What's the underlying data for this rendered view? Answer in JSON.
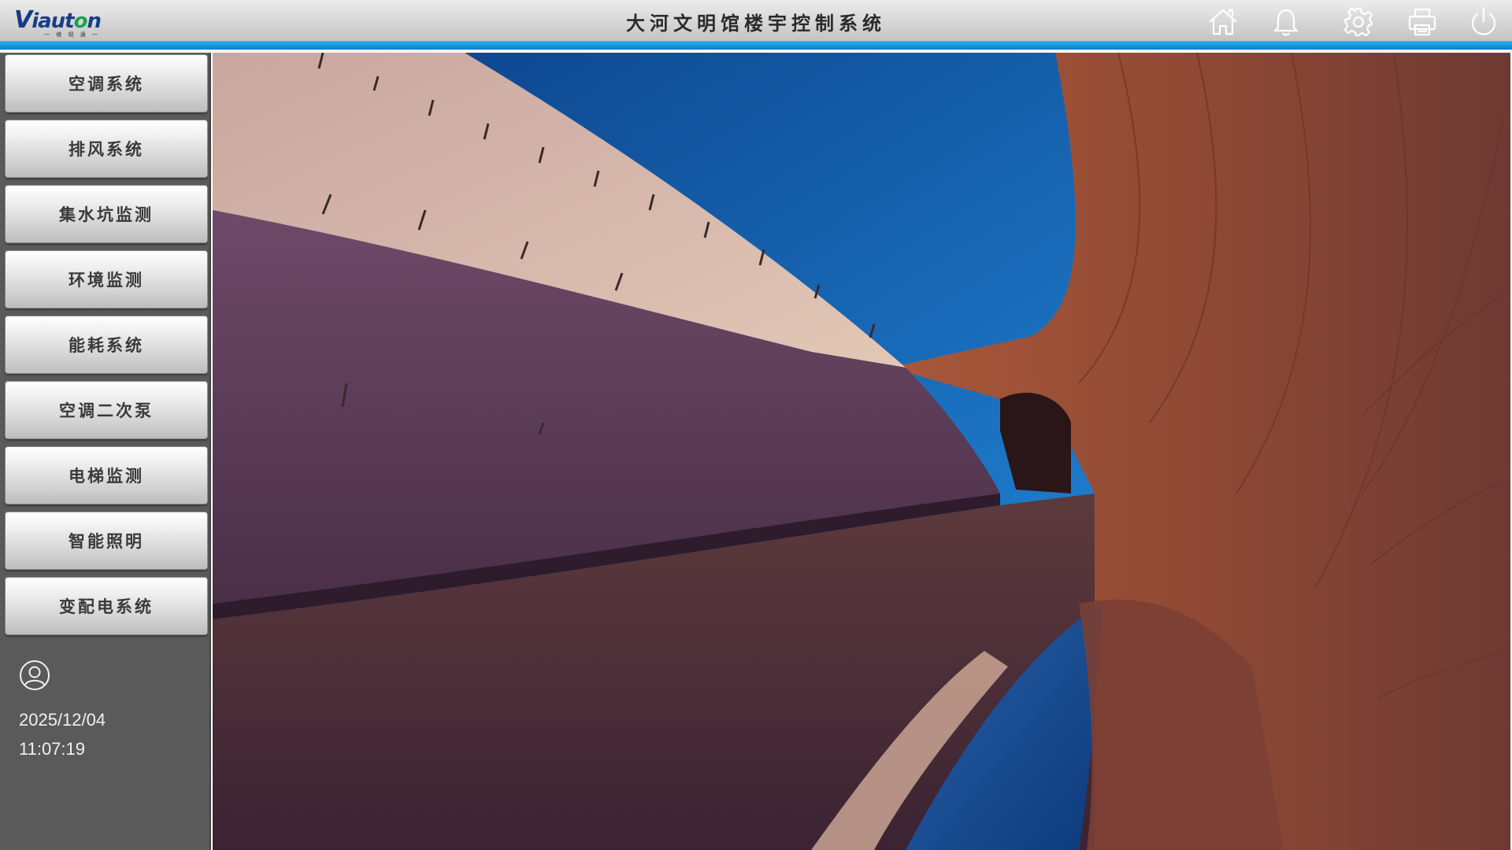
{
  "header": {
    "logo_text_v": "V",
    "logo_text_rest": "iaut",
    "logo_text_o": "o",
    "logo_text_end": "n",
    "logo_sub": "一 维 视 通 一",
    "title": "大河文明馆楼宇控制系统",
    "icons": [
      "home-icon",
      "bell-icon",
      "gear-icon",
      "printer-icon",
      "power-icon"
    ]
  },
  "colors": {
    "accent": "#0a8fe0",
    "sidebar_bg": "#5a5a5a",
    "header_bg": "#d6d6d6"
  },
  "sidebar": {
    "items": [
      {
        "label": "空调系统"
      },
      {
        "label": "排风系统"
      },
      {
        "label": "集水坑监测"
      },
      {
        "label": "环境监测"
      },
      {
        "label": "能耗系统"
      },
      {
        "label": "空调二次泵"
      },
      {
        "label": "电梯监测"
      },
      {
        "label": "智能照明"
      },
      {
        "label": "变配电系统"
      }
    ],
    "user_icon": "user-icon",
    "date": "2025/12/04",
    "time": "11:07:19"
  },
  "main": {
    "image": "museum-architecture-photo"
  }
}
